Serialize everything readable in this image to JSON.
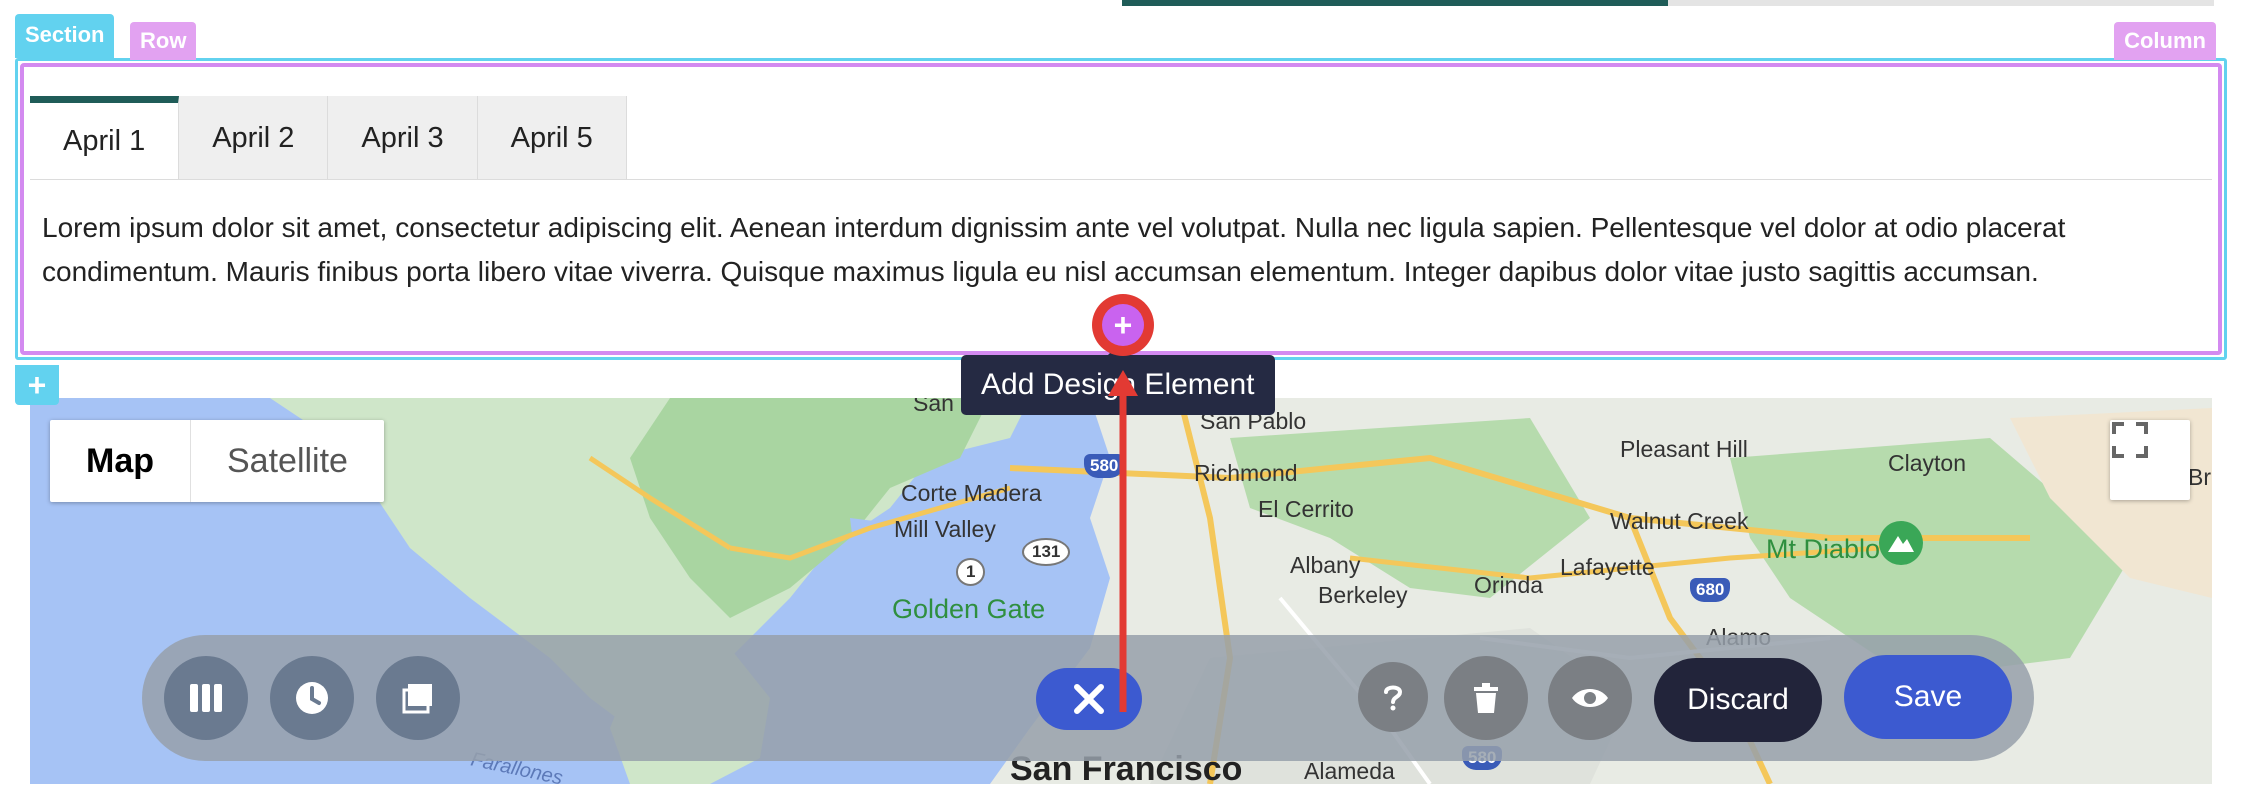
{
  "builder": {
    "section_label": "Section",
    "row_label": "Row",
    "column_label": "Column",
    "add_section_symbol": "+",
    "add_element_symbol": "+"
  },
  "tabs": [
    {
      "label": "April 1",
      "active": true
    },
    {
      "label": "April 2",
      "active": false
    },
    {
      "label": "April 3",
      "active": false
    },
    {
      "label": "April 5",
      "active": false
    }
  ],
  "tab_content": "Lorem ipsum dolor sit amet, consectetur adipiscing elit. Aenean interdum dignissim ante vel volutpat. Nulla nec ligula sapien. Pellentesque vel dolor at odio placerat condimentum. Mauris finibus porta libero vitae viverra. Quisque maximus ligula eu nisl accumsan elementum. Integer dapibus dolor vitae justo sagittis accumsan.",
  "tooltip": "Add Design Element",
  "map": {
    "type_map": "Map",
    "type_satellite": "Satellite",
    "labels": {
      "san_rafael": "San",
      "san_pablo": "San Pablo",
      "pleasant_hill": "Pleasant Hill",
      "clayton": "Clayton",
      "br": "Br",
      "richmond": "Richmond",
      "corte_madera": "Corte Madera",
      "el_cerrito": "El Cerrito",
      "walnut_creek": "Walnut Creek",
      "mill_valley": "Mill Valley",
      "mt_diablo": "Mt Diablo",
      "albany": "Albany",
      "lafayette": "Lafayette",
      "berkeley": "Berkeley",
      "orinda": "Orinda",
      "golden_gate": "Golden Gate",
      "alamo": "Alamo",
      "farallones": "Farallones",
      "san_francisco": "San Francisco",
      "alameda": "Alameda"
    },
    "shields": {
      "i580": "580",
      "i680": "680",
      "i580b": "580",
      "r131": "131",
      "r1": "1"
    }
  },
  "toolbar": {
    "discard_label": "Discard",
    "save_label": "Save"
  },
  "colors": {
    "section": "#62d2ef",
    "row": "#d38af0",
    "tab_accent": "#1f5c58",
    "primary": "#3c5ad0",
    "tooltip_bg": "#252a43",
    "annotation": "#e23a33"
  }
}
